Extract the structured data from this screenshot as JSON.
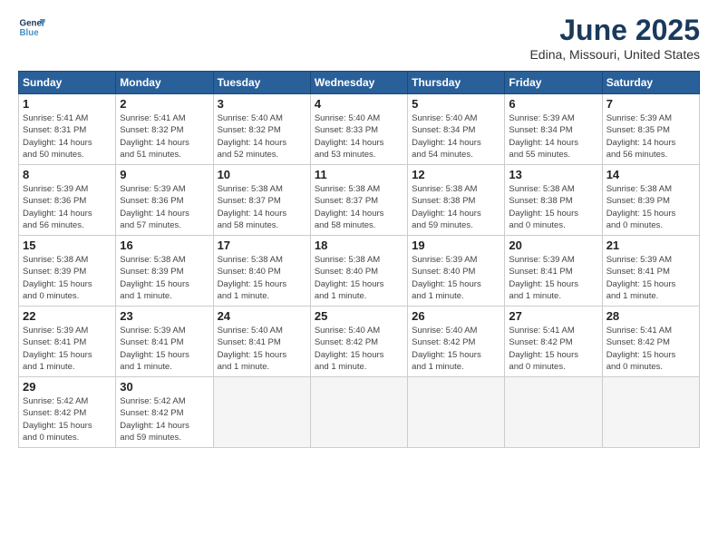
{
  "header": {
    "logo_line1": "General",
    "logo_line2": "Blue",
    "month": "June 2025",
    "location": "Edina, Missouri, United States"
  },
  "weekdays": [
    "Sunday",
    "Monday",
    "Tuesday",
    "Wednesday",
    "Thursday",
    "Friday",
    "Saturday"
  ],
  "weeks": [
    [
      {
        "day": "1",
        "info": "Sunrise: 5:41 AM\nSunset: 8:31 PM\nDaylight: 14 hours\nand 50 minutes."
      },
      {
        "day": "2",
        "info": "Sunrise: 5:41 AM\nSunset: 8:32 PM\nDaylight: 14 hours\nand 51 minutes."
      },
      {
        "day": "3",
        "info": "Sunrise: 5:40 AM\nSunset: 8:32 PM\nDaylight: 14 hours\nand 52 minutes."
      },
      {
        "day": "4",
        "info": "Sunrise: 5:40 AM\nSunset: 8:33 PM\nDaylight: 14 hours\nand 53 minutes."
      },
      {
        "day": "5",
        "info": "Sunrise: 5:40 AM\nSunset: 8:34 PM\nDaylight: 14 hours\nand 54 minutes."
      },
      {
        "day": "6",
        "info": "Sunrise: 5:39 AM\nSunset: 8:34 PM\nDaylight: 14 hours\nand 55 minutes."
      },
      {
        "day": "7",
        "info": "Sunrise: 5:39 AM\nSunset: 8:35 PM\nDaylight: 14 hours\nand 56 minutes."
      }
    ],
    [
      {
        "day": "8",
        "info": "Sunrise: 5:39 AM\nSunset: 8:36 PM\nDaylight: 14 hours\nand 56 minutes."
      },
      {
        "day": "9",
        "info": "Sunrise: 5:39 AM\nSunset: 8:36 PM\nDaylight: 14 hours\nand 57 minutes."
      },
      {
        "day": "10",
        "info": "Sunrise: 5:38 AM\nSunset: 8:37 PM\nDaylight: 14 hours\nand 58 minutes."
      },
      {
        "day": "11",
        "info": "Sunrise: 5:38 AM\nSunset: 8:37 PM\nDaylight: 14 hours\nand 58 minutes."
      },
      {
        "day": "12",
        "info": "Sunrise: 5:38 AM\nSunset: 8:38 PM\nDaylight: 14 hours\nand 59 minutes."
      },
      {
        "day": "13",
        "info": "Sunrise: 5:38 AM\nSunset: 8:38 PM\nDaylight: 15 hours\nand 0 minutes."
      },
      {
        "day": "14",
        "info": "Sunrise: 5:38 AM\nSunset: 8:39 PM\nDaylight: 15 hours\nand 0 minutes."
      }
    ],
    [
      {
        "day": "15",
        "info": "Sunrise: 5:38 AM\nSunset: 8:39 PM\nDaylight: 15 hours\nand 0 minutes."
      },
      {
        "day": "16",
        "info": "Sunrise: 5:38 AM\nSunset: 8:39 PM\nDaylight: 15 hours\nand 1 minute."
      },
      {
        "day": "17",
        "info": "Sunrise: 5:38 AM\nSunset: 8:40 PM\nDaylight: 15 hours\nand 1 minute."
      },
      {
        "day": "18",
        "info": "Sunrise: 5:38 AM\nSunset: 8:40 PM\nDaylight: 15 hours\nand 1 minute."
      },
      {
        "day": "19",
        "info": "Sunrise: 5:39 AM\nSunset: 8:40 PM\nDaylight: 15 hours\nand 1 minute."
      },
      {
        "day": "20",
        "info": "Sunrise: 5:39 AM\nSunset: 8:41 PM\nDaylight: 15 hours\nand 1 minute."
      },
      {
        "day": "21",
        "info": "Sunrise: 5:39 AM\nSunset: 8:41 PM\nDaylight: 15 hours\nand 1 minute."
      }
    ],
    [
      {
        "day": "22",
        "info": "Sunrise: 5:39 AM\nSunset: 8:41 PM\nDaylight: 15 hours\nand 1 minute."
      },
      {
        "day": "23",
        "info": "Sunrise: 5:39 AM\nSunset: 8:41 PM\nDaylight: 15 hours\nand 1 minute."
      },
      {
        "day": "24",
        "info": "Sunrise: 5:40 AM\nSunset: 8:41 PM\nDaylight: 15 hours\nand 1 minute."
      },
      {
        "day": "25",
        "info": "Sunrise: 5:40 AM\nSunset: 8:42 PM\nDaylight: 15 hours\nand 1 minute."
      },
      {
        "day": "26",
        "info": "Sunrise: 5:40 AM\nSunset: 8:42 PM\nDaylight: 15 hours\nand 1 minute."
      },
      {
        "day": "27",
        "info": "Sunrise: 5:41 AM\nSunset: 8:42 PM\nDaylight: 15 hours\nand 0 minutes."
      },
      {
        "day": "28",
        "info": "Sunrise: 5:41 AM\nSunset: 8:42 PM\nDaylight: 15 hours\nand 0 minutes."
      }
    ],
    [
      {
        "day": "29",
        "info": "Sunrise: 5:42 AM\nSunset: 8:42 PM\nDaylight: 15 hours\nand 0 minutes."
      },
      {
        "day": "30",
        "info": "Sunrise: 5:42 AM\nSunset: 8:42 PM\nDaylight: 14 hours\nand 59 minutes."
      },
      {
        "day": "",
        "info": ""
      },
      {
        "day": "",
        "info": ""
      },
      {
        "day": "",
        "info": ""
      },
      {
        "day": "",
        "info": ""
      },
      {
        "day": "",
        "info": ""
      }
    ]
  ]
}
